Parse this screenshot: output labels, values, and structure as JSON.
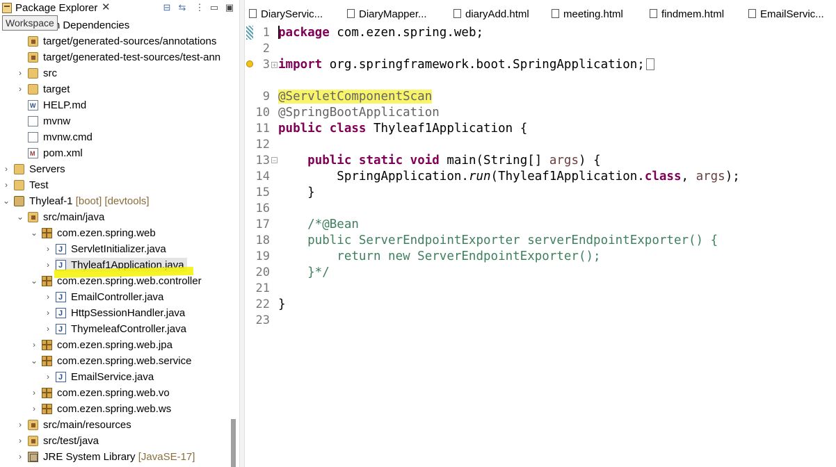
{
  "explorer": {
    "title": "Package Explorer",
    "close_glyph": "✕",
    "tooltip": "Workspace",
    "toolbar_icons": [
      "collapse-all-icon",
      "link-with-editor-icon",
      "view-menu-icon",
      "minimize-icon",
      "maximize-icon"
    ],
    "tree": [
      {
        "label": "Maven Dependencies",
        "visible_text": "ven Dependencies",
        "icon": "library-icon"
      },
      {
        "label": "target/generated-sources/annotations",
        "icon": "source-folder-icon"
      },
      {
        "label": "target/generated-test-sources/test-ann",
        "icon": "source-folder-icon"
      },
      {
        "label": "src",
        "icon": "folder-icon",
        "toggle": "›"
      },
      {
        "label": "target",
        "icon": "folder-icon",
        "toggle": "›"
      },
      {
        "label": "HELP.md",
        "icon": "markdown-file-icon"
      },
      {
        "label": "mvnw",
        "icon": "file-icon"
      },
      {
        "label": "mvnw.cmd",
        "icon": "file-icon"
      },
      {
        "label": "pom.xml",
        "icon": "maven-pom-icon"
      },
      {
        "label": "Servers",
        "icon": "folder-icon",
        "toggle": "›"
      },
      {
        "label": "Test",
        "icon": "folder-icon",
        "toggle": "›"
      },
      {
        "label": "Thyleaf-1",
        "decoration": "[boot] [devtools]",
        "icon": "project-icon",
        "toggle": "⌄"
      },
      {
        "label": "src/main/java",
        "icon": "source-folder-icon",
        "toggle": "⌄"
      },
      {
        "label": "com.ezen.spring.web",
        "icon": "package-icon",
        "toggle": "⌄"
      },
      {
        "label": "ServletInitializer.java",
        "icon": "java-file-icon",
        "toggle": "›"
      },
      {
        "label": "Thyleaf1Application.java",
        "icon": "java-file-icon",
        "toggle": "›",
        "selected": true
      },
      {
        "label": "com.ezen.spring.web.controller",
        "icon": "package-icon",
        "toggle": "⌄"
      },
      {
        "label": "EmailController.java",
        "icon": "java-file-icon",
        "toggle": "›"
      },
      {
        "label": "HttpSessionHandler.java",
        "icon": "java-file-icon",
        "toggle": "›"
      },
      {
        "label": "ThymeleafController.java",
        "icon": "java-file-icon",
        "toggle": "›"
      },
      {
        "label": "com.ezen.spring.web.jpa",
        "icon": "package-icon",
        "toggle": "›"
      },
      {
        "label": "com.ezen.spring.web.service",
        "icon": "package-icon",
        "toggle": "⌄"
      },
      {
        "label": "EmailService.java",
        "icon": "java-file-icon",
        "toggle": "›"
      },
      {
        "label": "com.ezen.spring.web.vo",
        "icon": "package-icon",
        "toggle": "›"
      },
      {
        "label": "com.ezen.spring.web.ws",
        "icon": "package-icon",
        "toggle": "›"
      },
      {
        "label": "src/main/resources",
        "icon": "source-folder-icon",
        "toggle": "›"
      },
      {
        "label": "src/test/java",
        "icon": "source-folder-icon",
        "toggle": "›"
      },
      {
        "label": "JRE System Library",
        "decoration": "[JavaSE-17]",
        "icon": "library-icon",
        "toggle": "›"
      }
    ]
  },
  "editor": {
    "tabs": [
      "DiaryServic...",
      "DiaryMapper...",
      "diaryAdd.html",
      "meeting.html",
      "findmem.html",
      "EmailServic..."
    ],
    "line_numbers": [
      "1",
      "2",
      "3",
      "9",
      "10",
      "11",
      "12",
      "13",
      "14",
      "15",
      "16",
      "17",
      "18",
      "19",
      "20",
      "21",
      "22",
      "23"
    ],
    "code": {
      "l1_kw": "package",
      "l1_rest": " com.ezen.spring.web;",
      "l3_kw": "import",
      "l3_rest": " org.springframework.boot.SpringApplication;",
      "l9": "@ServletComponentScan",
      "l10": "@SpringBootApplication",
      "l11_kw": "public class",
      "l11_rest": " Thyleaf1Application {",
      "l13_indent": "    ",
      "l13_kw": "public static void",
      "l13_a": " main(String[] ",
      "l13_param": "args",
      "l13_b": ") {",
      "l14_a": "        SpringApplication.",
      "l14_run": "run",
      "l14_b": "(Thyleaf1Application.",
      "l14_kw": "class",
      "l14_c": ", ",
      "l14_param": "args",
      "l14_d": ");",
      "l15": "    }",
      "l17": "    /*@Bean",
      "l18": "    public ServerEndpointExporter serverEndpointExporter() {",
      "l19": "        return new ServerEndpointExporter();",
      "l20": "    }*/",
      "l22": "}"
    }
  }
}
